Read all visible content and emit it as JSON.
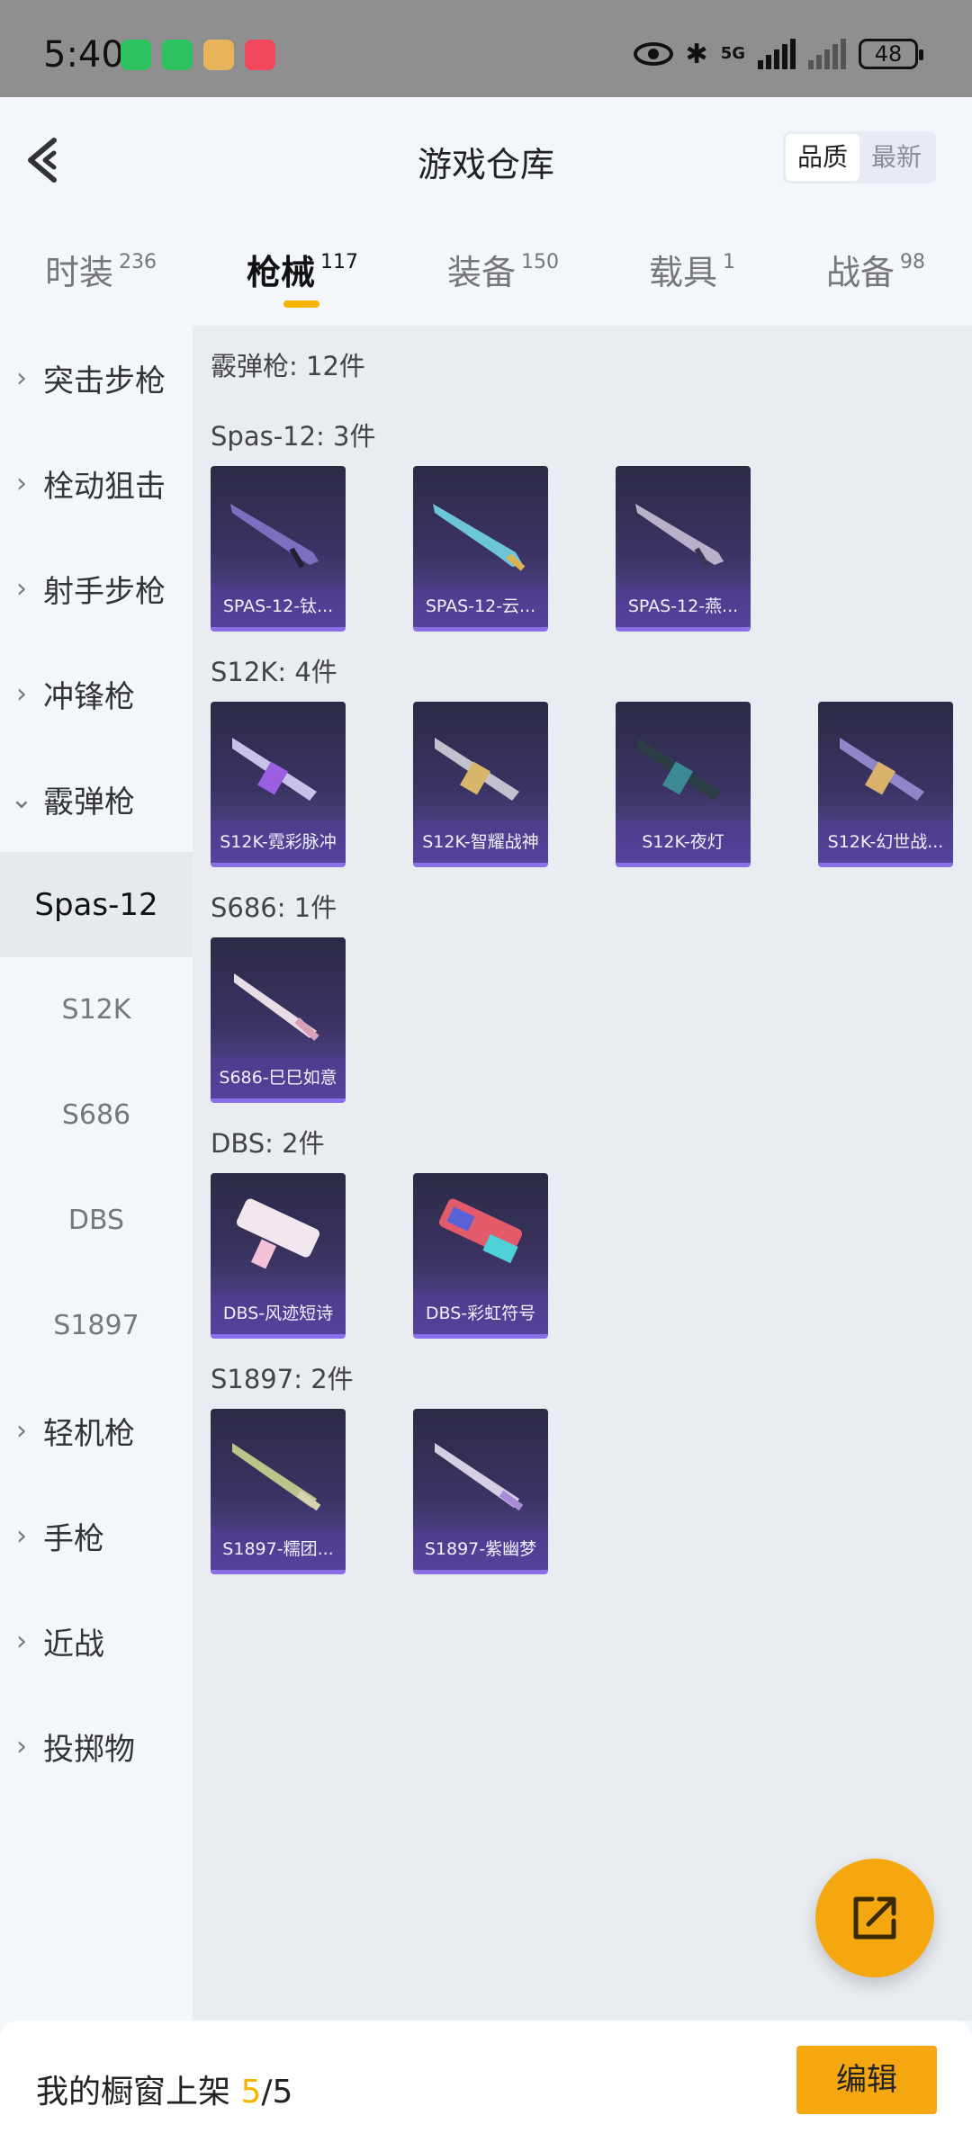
{
  "status_bar": {
    "time": "5:40",
    "network": "5G",
    "battery": "48"
  },
  "header": {
    "title": "游戏仓库",
    "back_icon": "back-arrow-icon",
    "sort_options": [
      "品质",
      "最新"
    ],
    "sort_selected": "品质"
  },
  "tabs": [
    {
      "label": "时装",
      "count": "236"
    },
    {
      "label": "枪械",
      "count": "117"
    },
    {
      "label": "装备",
      "count": "150"
    },
    {
      "label": "载具",
      "count": "1"
    },
    {
      "label": "战备",
      "count": "98"
    }
  ],
  "sidebar": {
    "categories": [
      "突击步枪",
      "栓动狙击",
      "射手步枪",
      "冲锋枪",
      "霰弹枪",
      "轻机枪",
      "手枪",
      "近战",
      "投掷物"
    ],
    "sub_items": [
      "Spas-12",
      "S12K",
      "S686",
      "DBS",
      "S1897"
    ]
  },
  "content": {
    "summary": "霰弹枪: 12件",
    "groups": [
      {
        "header": "Spas-12: 3件",
        "items": [
          "SPAS-12-钛...",
          "SPAS-12-云...",
          "SPAS-12-燕..."
        ]
      },
      {
        "header": "S12K: 4件",
        "items": [
          "S12K-霓彩脉冲",
          "S12K-智耀战神",
          "S12K-夜灯",
          "S12K-幻世战..."
        ]
      },
      {
        "header": "S686: 1件",
        "items": [
          "S686-巳巳如意"
        ]
      },
      {
        "header": "DBS: 2件",
        "items": [
          "DBS-风迹短诗",
          "DBS-彩虹符号"
        ]
      },
      {
        "header": "S1897: 2件",
        "items": [
          "S1897-糯团...",
          "S1897-紫幽梦"
        ]
      }
    ]
  },
  "fab": {
    "icon": "share-external-icon"
  },
  "bottom_bar": {
    "label": "我的橱窗上架",
    "count": "5",
    "total": "/5",
    "edit_label": "编辑"
  },
  "colors": {
    "accent": "#f5a70f",
    "card_bg": "#3b3363",
    "card_border": "#8a6fe8"
  }
}
